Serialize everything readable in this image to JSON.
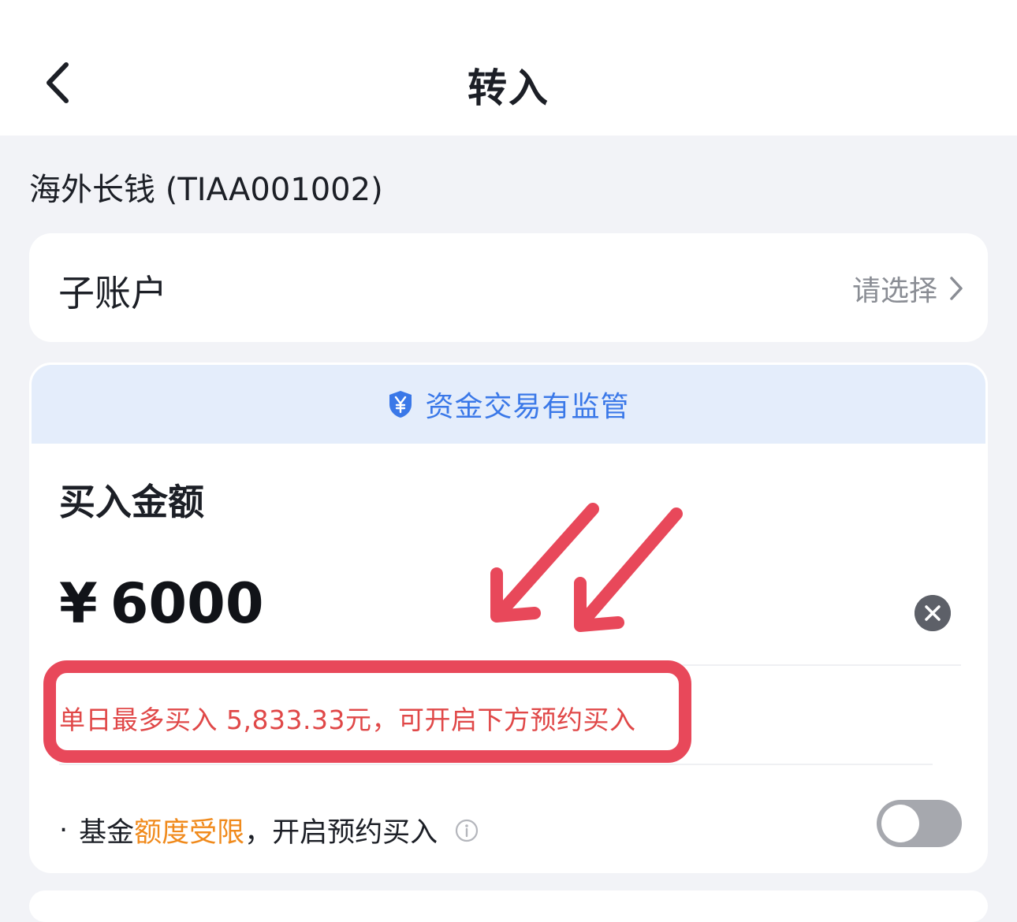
{
  "nav": {
    "title": "转入",
    "back_icon": "chevron-left-icon"
  },
  "fund": {
    "name": "海外长钱 (TIAA001002)"
  },
  "sub_account": {
    "label": "子账户",
    "placeholder": "请选择"
  },
  "supervision_banner": {
    "text": "资金交易有监管",
    "icon": "shield-yen-icon",
    "color": "#3a78e8"
  },
  "buy": {
    "title": "买入金额",
    "currency": "¥",
    "amount": "6000",
    "warning": "单日最多买入 5,833.33元，可开启下方预约买入",
    "warning_color": "#e04848"
  },
  "reserve": {
    "bullet": "·",
    "prefix": "基金",
    "highlight": "额度受限",
    "suffix": "，开启预约买入",
    "highlight_color": "#f08a1c",
    "toggle_on": false
  },
  "annotation": {
    "color": "#e8485a"
  }
}
